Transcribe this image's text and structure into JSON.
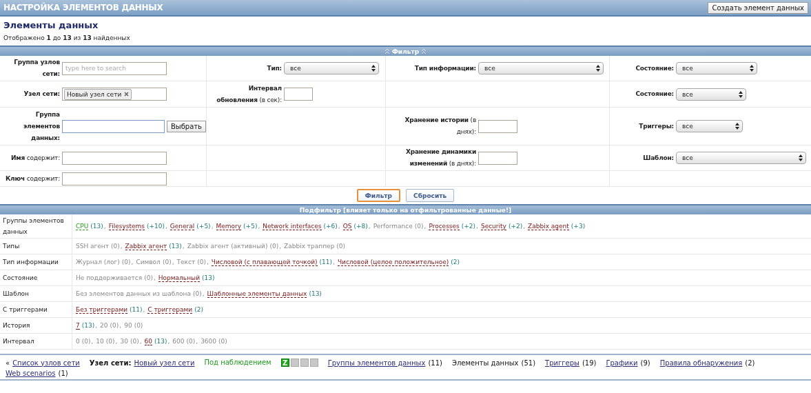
{
  "header": {
    "title": "НАСТРОЙКА ЭЛЕМЕНТОВ ДАННЫХ",
    "create_button": "Создать элемент данных"
  },
  "page_title": "Элементы данных",
  "summary": "Отображено **1** до **13** из **13** найденных",
  "filter": {
    "title": "Фильтр",
    "rows": [
      {
        "cells": [
          {
            "label": "**Группа узлов сети:**",
            "control": {
              "kind": "search",
              "placeholder": "type here to search"
            }
          },
          {
            "label": "**Тип:**",
            "control": {
              "kind": "select",
              "value": "все"
            }
          },
          {
            "label": "**Тип информации:**",
            "control": {
              "kind": "select",
              "value": "все"
            }
          },
          {
            "label": "**Состояние:**",
            "control": {
              "kind": "select",
              "value": "все"
            }
          }
        ]
      },
      {
        "cells": [
          {
            "label": "**Узел сети:**",
            "control": {
              "kind": "chips",
              "chips": [
                "Новый узел сети"
              ]
            }
          },
          {
            "label": "**Интервал обновления** (в сек):",
            "control": {
              "kind": "number"
            }
          },
          null,
          {
            "label": "**Состояние:**",
            "control": {
              "kind": "select",
              "value": "все"
            }
          }
        ]
      },
      {
        "cells": [
          {
            "label": "**Группа элементов данных:**",
            "control": {
              "kind": "picker",
              "button": "Выбрать"
            }
          },
          null,
          {
            "label": "**Хранение истории** (в днях):",
            "control": {
              "kind": "number"
            }
          },
          {
            "label": "**Триггеры:**",
            "control": {
              "kind": "select",
              "value": "все"
            }
          }
        ]
      },
      {
        "cells": [
          {
            "label": "**Имя** содержит:",
            "control": {
              "kind": "text"
            }
          },
          null,
          {
            "label": "**Хранение динамики изменений** (в днях):",
            "control": {
              "kind": "number"
            }
          },
          {
            "label": "**Шаблон:**",
            "control": {
              "kind": "select",
              "value": "все"
            }
          }
        ]
      },
      {
        "cells": [
          {
            "label": "**Ключ** содержит:",
            "control": {
              "kind": "text"
            }
          },
          null,
          null,
          null
        ]
      }
    ],
    "buttons": [
      {
        "label": "Фильтр",
        "kind": "primary"
      },
      {
        "label": "Сбросить",
        "kind": "secondary"
      }
    ]
  },
  "subfilter": {
    "title": "Подфильтр [влияет только на отфильтрованные данные!]",
    "rows": [
      {
        "label": "Группы элементов данных",
        "items": [
          {
            "name": "CPU",
            "count": "(13)",
            "kind": "selected",
            "separator": ","
          },
          {
            "name": "Filesystems",
            "count": "(+10)",
            "kind": "link",
            "separator": ","
          },
          {
            "name": "General",
            "count": "(+5)",
            "kind": "link",
            "separator": ","
          },
          {
            "name": "Memory",
            "count": "(+5)",
            "kind": "link",
            "separator": ","
          },
          {
            "name": "Network interfaces",
            "count": "(+6)",
            "kind": "link",
            "separator": ","
          },
          {
            "name": "OS",
            "count": "(+8)",
            "kind": "link",
            "separator": ","
          },
          {
            "name": "Performance",
            "count": "(0)",
            "kind": "empty",
            "separator": ","
          },
          {
            "name": "Processes",
            "count": "(+2)",
            "kind": "link",
            "separator": ","
          },
          {
            "name": "Security",
            "count": "(+2)",
            "kind": "link",
            "separator": ","
          },
          {
            "name": "Zabbix agent",
            "count": "(+3)",
            "kind": "link"
          }
        ]
      },
      {
        "label": "Типы",
        "items": [
          {
            "name": "SSH агент",
            "count": "(0)",
            "kind": "empty",
            "separator": ","
          },
          {
            "name": "Zabbix агент",
            "count": "(13)",
            "kind": "link",
            "separator": ","
          },
          {
            "name": "Zabbix агент (активный)",
            "count": "(0)",
            "kind": "empty",
            "separator": ","
          },
          {
            "name": "Zabbix траппер",
            "count": "(0)",
            "kind": "empty"
          }
        ]
      },
      {
        "label": "Тип информации",
        "items": [
          {
            "name": "Журнал (лог)",
            "count": "(0)",
            "kind": "empty",
            "separator": ","
          },
          {
            "name": "Символ",
            "count": "(0)",
            "kind": "empty",
            "separator": ","
          },
          {
            "name": "Текст",
            "count": "(0)",
            "kind": "empty",
            "separator": ","
          },
          {
            "name": "Числовой (с плавающей точкой)",
            "count": "(11)",
            "kind": "link",
            "separator": ","
          },
          {
            "name": "Числовой (целое положительное)",
            "count": "(2)",
            "kind": "link"
          }
        ]
      },
      {
        "label": "Состояние",
        "items": [
          {
            "name": "Не поддерживается",
            "count": "(0)",
            "kind": "empty",
            "separator": ","
          },
          {
            "name": "Нормальный",
            "count": "(13)",
            "kind": "link"
          }
        ]
      },
      {
        "label": "Шаблон",
        "items": [
          {
            "name": "Без элементов данных из шаблона",
            "count": "(0)",
            "kind": "empty",
            "separator": ","
          },
          {
            "name": "Шаблонные элементы данных",
            "count": "(13)",
            "kind": "link"
          }
        ]
      },
      {
        "label": "С триггерами",
        "items": [
          {
            "name": "Без триггерами",
            "count": "(11)",
            "kind": "link",
            "separator": ","
          },
          {
            "name": "С триггерами",
            "count": "(2)",
            "kind": "link"
          }
        ]
      },
      {
        "label": "История",
        "items": [
          {
            "name": "7",
            "count": "(13)",
            "kind": "link",
            "separator": ","
          },
          {
            "name": "20",
            "count": "(0)",
            "kind": "empty",
            "separator": ","
          },
          {
            "name": "90",
            "count": "(0)",
            "kind": "empty"
          }
        ]
      },
      {
        "label": "Интервал",
        "items": [
          {
            "name": "0",
            "count": "(0)",
            "kind": "empty",
            "separator": ","
          },
          {
            "name": "10",
            "count": "(0)",
            "kind": "empty",
            "separator": ","
          },
          {
            "name": "30",
            "count": "(0)",
            "kind": "empty",
            "separator": ","
          },
          {
            "name": "60",
            "count": "(13)",
            "kind": "link",
            "separator": ","
          },
          {
            "name": "600",
            "count": "(0)",
            "kind": "empty",
            "separator": ","
          },
          {
            "name": "3600",
            "count": "(0)",
            "kind": "empty"
          }
        ]
      }
    ]
  },
  "host_nav": {
    "back_mark": "«",
    "host_list": "Список узлов сети",
    "host_label": "Узел сети:",
    "host_name": "Новый узел сети",
    "status": "Под наблюдением",
    "availability": [
      {
        "label": "Z",
        "on": true
      },
      {
        "on": false
      },
      {
        "on": false
      },
      {
        "on": false
      }
    ],
    "links": [
      {
        "label": "Группы элементов данных",
        "count": "(11)",
        "selected": false
      },
      {
        "label": "Элементы данных",
        "count": "(51)",
        "selected": true
      },
      {
        "label": "Триггеры",
        "count": "(19)",
        "selected": false
      },
      {
        "label": "Графики",
        "count": "(9)",
        "selected": false
      },
      {
        "label": "Правила обнаружения",
        "count": "(2)",
        "selected": false
      },
      {
        "label": "Web scenarios",
        "count": "(1)",
        "selected": false
      }
    ]
  }
}
